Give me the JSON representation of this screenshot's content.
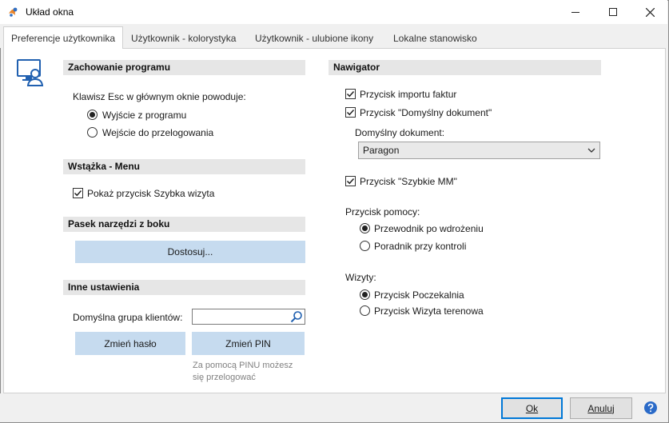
{
  "window": {
    "title": "Układ okna",
    "minimize_icon": "minimize-icon",
    "maximize_icon": "maximize-icon",
    "close_icon": "close-icon"
  },
  "tabs": [
    {
      "label": "Preferencje użytkownika",
      "active": true
    },
    {
      "label": "Użytkownik - kolorystyka",
      "active": false
    },
    {
      "label": "Użytkownik - ulubione ikony",
      "active": false
    },
    {
      "label": "Lokalne stanowisko",
      "active": false
    }
  ],
  "left": {
    "program_behavior": {
      "header": "Zachowanie programu",
      "esc_label": "Klawisz Esc w głównym oknie powoduje:",
      "options": [
        {
          "label": "Wyjście z programu",
          "selected": true
        },
        {
          "label": "Wejście do przelogowania",
          "selected": false
        }
      ]
    },
    "ribbon": {
      "header": "Wstążka - Menu",
      "show_quick_visit": {
        "label": "Pokaż przycisk Szybka wizyta",
        "checked": true
      }
    },
    "side_toolbar": {
      "header": "Pasek narzędzi z boku",
      "customize_button": "Dostosuj..."
    },
    "other": {
      "header": "Inne ustawienia",
      "default_group_label": "Domyślna grupa klientów:",
      "default_group_value": "",
      "change_password_button": "Zmień hasło",
      "change_pin_button": "Zmień PIN",
      "pin_hint_line1": "Za pomocą PINU możesz",
      "pin_hint_line2": "się przelogować"
    }
  },
  "navigator": {
    "header": "Nawigator",
    "import_invoices": {
      "label": "Przycisk importu faktur",
      "checked": true
    },
    "default_document": {
      "label": "Przycisk \"Domyślny dokument\"",
      "checked": true
    },
    "default_document_label": "Domyślny dokument:",
    "default_document_value": "Paragon",
    "quick_mm": {
      "label": "Przycisk \"Szybkie MM\"",
      "checked": true
    },
    "help_button_label": "Przycisk pomocy:",
    "help_options": [
      {
        "label": "Przewodnik po wdrożeniu",
        "selected": true
      },
      {
        "label": "Poradnik przy kontroli",
        "selected": false
      }
    ],
    "visits_label": "Wizyty:",
    "visit_options": [
      {
        "label": "Przycisk Poczekalnia",
        "selected": true
      },
      {
        "label": "Przycisk Wizyta terenowa",
        "selected": false
      }
    ]
  },
  "footer": {
    "ok_button": "Ok",
    "cancel_button": "Anuluj",
    "help_icon": "help-icon"
  },
  "colors": {
    "accent": "#0078d7",
    "button_blue": "#c6dbef",
    "section_header_bg": "#e6e6e6"
  }
}
